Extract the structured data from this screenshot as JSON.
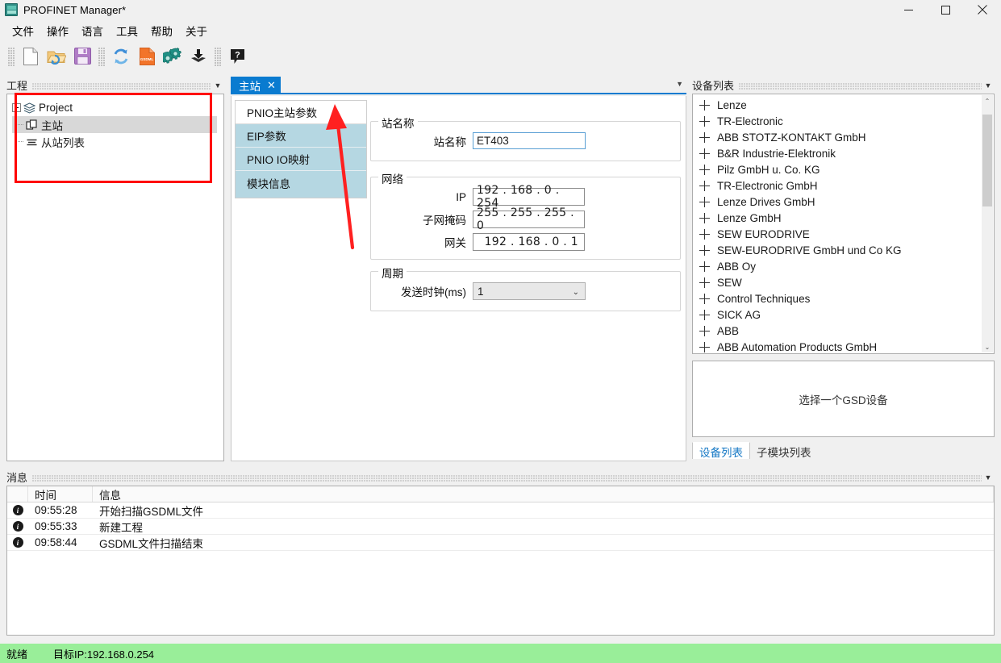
{
  "window": {
    "title": "PROFINET Manager*",
    "app_icon": "circuit-board-icon",
    "minimize": "—",
    "maximize": "▢",
    "close": "✕"
  },
  "menubar": {
    "items": [
      {
        "label": "文件",
        "name": "menu-file"
      },
      {
        "label": "操作",
        "name": "menu-operation"
      },
      {
        "label": "语言",
        "name": "menu-language"
      },
      {
        "label": "工具",
        "name": "menu-tools"
      },
      {
        "label": "帮助",
        "name": "menu-help"
      },
      {
        "label": "关于",
        "name": "menu-about"
      }
    ]
  },
  "toolbar": {
    "buttons": [
      {
        "name": "new-file-icon",
        "title": "新建"
      },
      {
        "name": "open-folder-icon",
        "title": "打开"
      },
      {
        "name": "save-disk-icon",
        "title": "保存"
      },
      {
        "name": "refresh-icon",
        "title": "刷新"
      },
      {
        "name": "gsdml-file-icon",
        "title": "GSDML"
      },
      {
        "name": "gears-config-icon",
        "title": "配置"
      },
      {
        "name": "download-icon",
        "title": "下载"
      },
      {
        "name": "help-icon",
        "title": "帮助"
      }
    ]
  },
  "project_panel": {
    "caption": "工程",
    "collapse_icon": "chevron-down-icon",
    "tree": [
      {
        "label": "Project",
        "icon": "layers-icon",
        "level": 0,
        "expanded": true,
        "selected": false
      },
      {
        "label": "主站",
        "icon": "master-station-icon",
        "level": 1,
        "selected": true
      },
      {
        "label": "从站列表",
        "icon": "slave-list-icon",
        "level": 1,
        "selected": false
      }
    ]
  },
  "center": {
    "tab": {
      "label": "主站",
      "close_icon": "✕"
    },
    "overflow_icon": "chevron-down-icon",
    "side_tabs": [
      {
        "label": "PNIO主站参数",
        "active": true
      },
      {
        "label": "EIP参数",
        "active": false
      },
      {
        "label": "PNIO IO映射",
        "active": false
      },
      {
        "label": "模块信息",
        "active": false
      }
    ],
    "groups": {
      "station_name": {
        "title": "站名称",
        "field_label": "站名称",
        "field_value": "ET403"
      },
      "network": {
        "title": "网络",
        "fields": [
          {
            "label": "IP",
            "value": "192 . 168 .  0  . 254"
          },
          {
            "label": "子网掩码",
            "value": "255 . 255 . 255 .  0 "
          },
          {
            "label": "网关",
            "value": "192 . 168 .  0  .  1 "
          }
        ]
      },
      "cycle": {
        "title": "周期",
        "field_label": "发送时钟(ms)",
        "field_value": "1",
        "arrow_icon": "chevron-down-icon"
      }
    }
  },
  "device_panel": {
    "caption": "设备列表",
    "collapse_icon": "chevron-down-icon",
    "items": [
      "Lenze",
      "TR-Electronic",
      "ABB STOTZ-KONTAKT GmbH",
      "B&R Industrie-Elektronik",
      "Pilz GmbH u. Co. KG",
      "TR-Electronic GmbH",
      "Lenze Drives GmbH",
      "Lenze GmbH",
      "SEW EURODRIVE",
      "SEW-EURODRIVE GmbH und Co KG",
      "ABB Oy",
      "SEW",
      "Control Techniques",
      "SICK AG",
      "ABB",
      "ABB Automation Products GmbH"
    ],
    "scroll_up_icon": "chevron-up-icon",
    "scroll_down_icon": "chevron-down-icon",
    "preview_placeholder": "选择一个GSD设备",
    "bottom_tabs": [
      {
        "label": "设备列表",
        "active": true
      },
      {
        "label": "子模块列表",
        "active": false
      }
    ]
  },
  "message_panel": {
    "caption": "消息",
    "collapse_icon": "chevron-down-icon",
    "columns": [
      "",
      "时间",
      "信息"
    ],
    "rows": [
      {
        "icon": "info-icon",
        "time": "09:55:28",
        "message": "开始扫描GSDML文件"
      },
      {
        "icon": "info-icon",
        "time": "09:55:33",
        "message": "新建工程"
      },
      {
        "icon": "info-icon",
        "time": "09:58:44",
        "message": "GSDML文件扫描结束"
      }
    ]
  },
  "statusbar": {
    "state": "就绪",
    "target": "目标IP:192.168.0.254",
    "background_color": "#99ee99"
  },
  "annotations": {
    "red_box": "highlight-project-tree",
    "red_arrow": "points-to-pnio-master-params-tab",
    "color": "#ff0000"
  }
}
